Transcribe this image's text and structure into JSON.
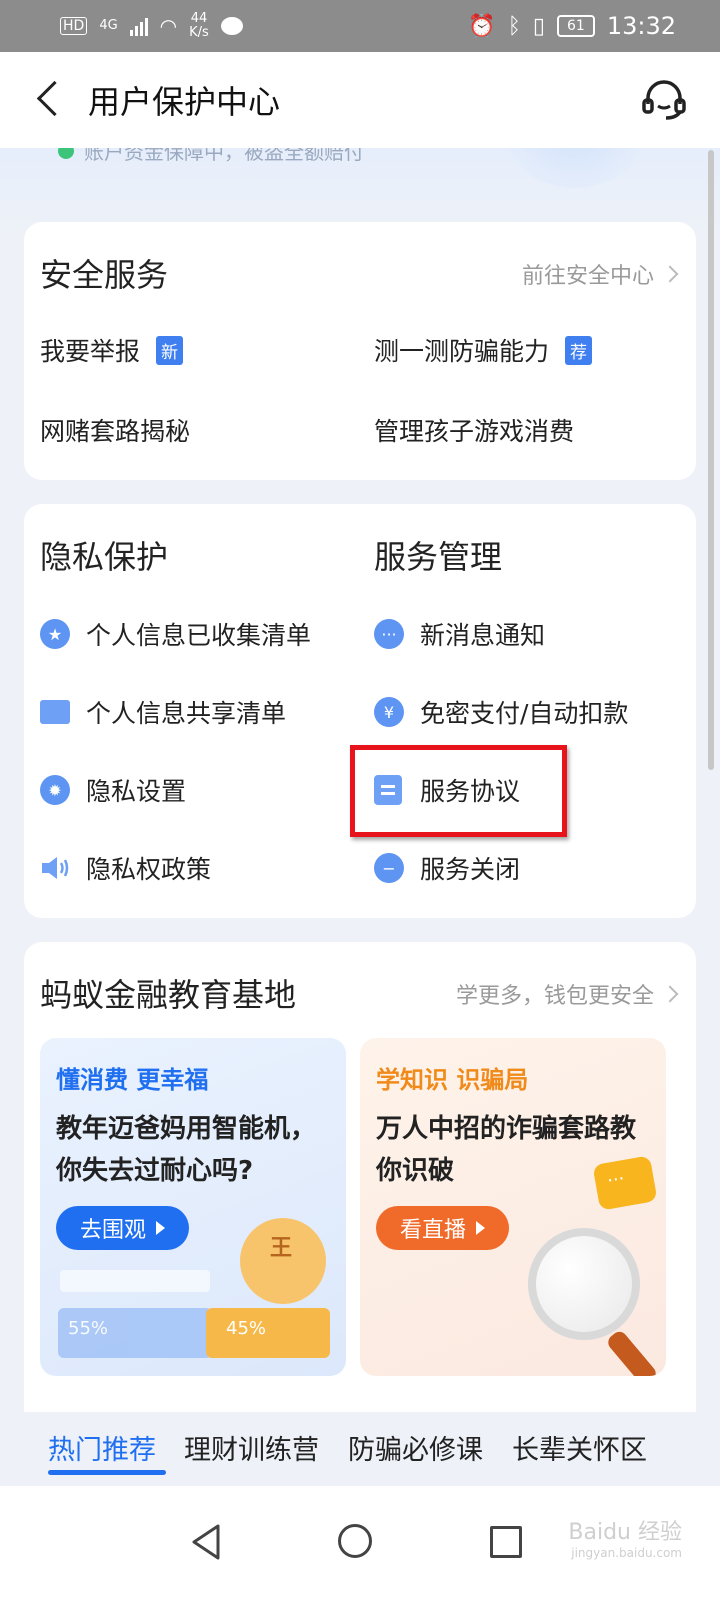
{
  "status_bar": {
    "hd": "HD",
    "network": "4G",
    "speed_value": "44",
    "speed_unit": "K/s",
    "battery": "61",
    "time": "13:32"
  },
  "header": {
    "title": "用户保护中心",
    "back_icon": "chevron-left-icon",
    "support_icon": "headset-icon"
  },
  "hero": {
    "status_text": "账户资金保障中，被盗全额赔付"
  },
  "security_card": {
    "title": "安全服务",
    "link": "前往安全中心",
    "items": [
      {
        "label": "我要举报",
        "badge": "新"
      },
      {
        "label": "测一测防骗能力",
        "badge": "荐"
      },
      {
        "label": "网赌套路揭秘",
        "badge": ""
      },
      {
        "label": "管理孩子游戏消费",
        "badge": ""
      }
    ]
  },
  "privacy_card": {
    "privacy_title": "隐私保护",
    "service_title": "服务管理",
    "privacy_items": [
      {
        "label": "个人信息已收集清单",
        "icon": "star-icon"
      },
      {
        "label": "个人信息共享清单",
        "icon": "folder-icon"
      },
      {
        "label": "隐私设置",
        "icon": "gear-icon"
      },
      {
        "label": "隐私权政策",
        "icon": "speaker-icon"
      }
    ],
    "service_items": [
      {
        "label": "新消息通知",
        "icon": "message-icon"
      },
      {
        "label": "免密支付/自动扣款",
        "icon": "yuan-icon"
      },
      {
        "label": "服务协议",
        "icon": "document-icon"
      },
      {
        "label": "服务关闭",
        "icon": "minus-icon"
      }
    ]
  },
  "education": {
    "title": "蚂蚁金融教育基地",
    "link": "学更多，钱包更安全",
    "promo_left": {
      "tag": "懂消费 更幸福",
      "text": "教年迈爸妈用智能机，你失去过耐心吗?",
      "button": "去围观",
      "pct_left": "55%",
      "pct_right": "45%"
    },
    "promo_right": {
      "tag": "学知识 识骗局",
      "text": "万人中招的诈骗套路教你识破",
      "button": "看直播"
    }
  },
  "tabs": [
    "热门推荐",
    "理财训练营",
    "防骗必修课",
    "长辈关怀区"
  ],
  "watermark": {
    "brand": "Baidu 经验",
    "url": "jingyan.baidu.com"
  },
  "colors": {
    "accent": "#1f6ff0",
    "highlight": "#e8141c",
    "orange": "#f06a2a"
  }
}
